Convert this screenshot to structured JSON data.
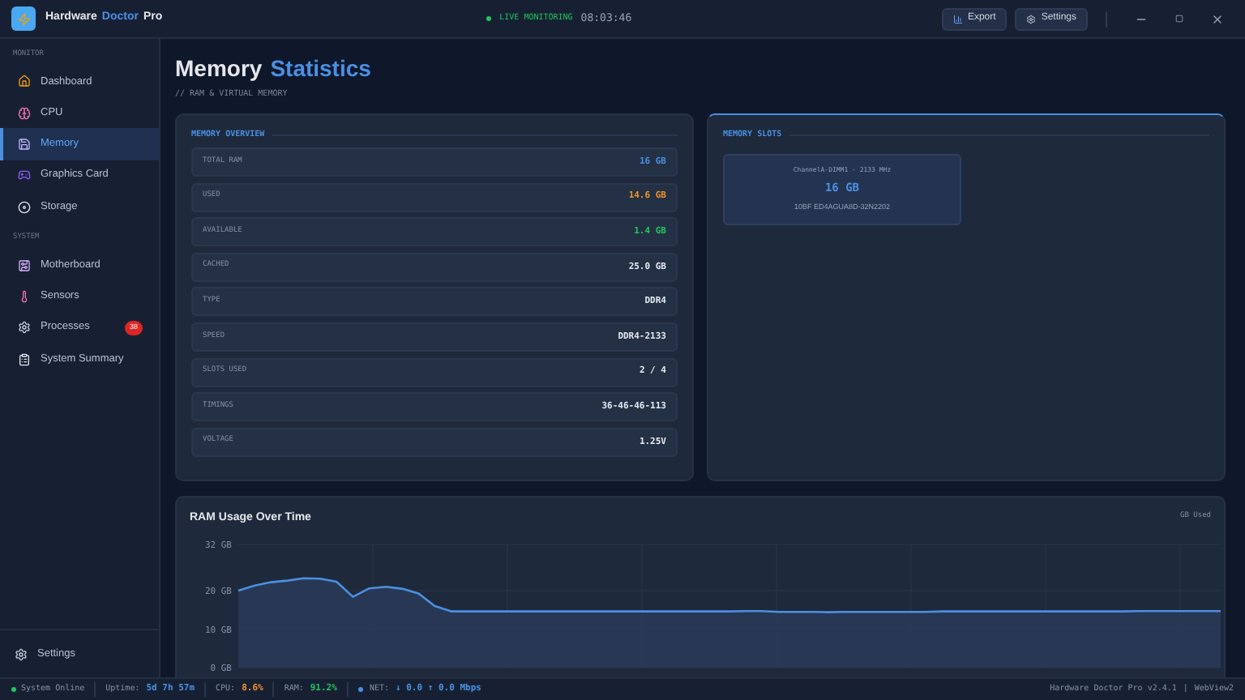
{
  "app": {
    "title_parts": [
      {
        "text": "Hardware",
        "accent": false
      },
      {
        "text": "Doctor",
        "accent": true
      },
      {
        "text": "Pro",
        "accent": false
      }
    ],
    "live": "LIVE MONITORING",
    "clock": "08:03:46",
    "buttons": [
      "Export",
      "Settings"
    ]
  },
  "sidebar": {
    "sections": [
      {
        "title": "MONITOR",
        "items": [
          {
            "label": "Dashboard",
            "selected": false
          },
          {
            "label": "CPU",
            "selected": false
          },
          {
            "label": "Memory",
            "selected": true
          },
          {
            "label": "Graphics Card",
            "selected": false
          },
          {
            "label": "Storage",
            "selected": false
          }
        ]
      },
      {
        "title": "SYSTEM",
        "items": [
          {
            "label": "Motherboard",
            "selected": false
          },
          {
            "label": "Sensors",
            "selected": false
          },
          {
            "label": "Processes",
            "selected": false,
            "badge": "38"
          },
          {
            "label": "System Summary",
            "selected": false
          }
        ]
      }
    ],
    "footer": {
      "label": "Settings"
    }
  },
  "page": {
    "title_parts": [
      {
        "text": "Memory",
        "accent": false
      },
      {
        "text": "Statistics",
        "accent": true
      }
    ],
    "subtitle": "// RAM & VIRTUAL MEMORY"
  },
  "overview": {
    "title": "MEMORY OVERVIEW",
    "rows": [
      {
        "label": "TOTAL RAM",
        "value": "16 GB",
        "color": "#4a90e2"
      },
      {
        "label": "USED",
        "value": "14.6 GB",
        "color": "#f0932b"
      },
      {
        "label": "AVAILABLE",
        "value": "1.4 GB",
        "color": "#22c55e"
      },
      {
        "label": "CACHED",
        "value": "25.0 GB",
        "color": "#e2e8f0"
      },
      {
        "label": "TYPE",
        "value": "DDR4",
        "color": "#e2e8f0"
      },
      {
        "label": "SPEED",
        "value": "DDR4-2133",
        "color": "#e2e8f0"
      },
      {
        "label": "SLOTS USED",
        "value": "2 / 4",
        "color": "#e2e8f0"
      },
      {
        "label": "TIMINGS",
        "value": "36-46-46-113",
        "color": "#e2e8f0"
      },
      {
        "label": "VOLTAGE",
        "value": "1.25V",
        "color": "#e2e8f0"
      }
    ]
  },
  "slots": {
    "title": "MEMORY SLOTS",
    "items": [
      {
        "name": "ChannelA-DIMM1 · 2133 MHz",
        "size": "16 GB",
        "part": "10BF ED4AGUA8D-32N2202"
      }
    ]
  },
  "usage": {
    "chart_data": {
      "type": "area",
      "title": "RAM Usage Over Time",
      "grid": true,
      "ylim": [
        0,
        32
      ],
      "yticks": [
        {
          "value": 0,
          "label": "0 GB"
        },
        {
          "value": 10,
          "label": "10 GB"
        },
        {
          "value": 20,
          "label": "20 GB"
        },
        {
          "value": 32,
          "label": "32 GB"
        }
      ],
      "series": [
        {
          "name": "GB Used",
          "color": "#4a90e2",
          "values": [
            20,
            21.3,
            22.2,
            22.6,
            23.2,
            23.1,
            22.3,
            18.4,
            20.6,
            21,
            20.5,
            19.3,
            16,
            14.6,
            14.6,
            14.6,
            14.6,
            14.6,
            14.6,
            14.6,
            14.6,
            14.6,
            14.6,
            14.6,
            14.6,
            14.6,
            14.6,
            14.6,
            14.6,
            14.6,
            14.6,
            14.7,
            14.7,
            14.5,
            14.5,
            14.5,
            14.4,
            14.5,
            14.5,
            14.5,
            14.5,
            14.5,
            14.5,
            14.6,
            14.6,
            14.6,
            14.6,
            14.6,
            14.6,
            14.6,
            14.6,
            14.6,
            14.6,
            14.6,
            14.6,
            14.7,
            14.7,
            14.7,
            14.7,
            14.7,
            14.7
          ]
        }
      ]
    }
  },
  "status_bar": {
    "online": "System Online",
    "items": [
      {
        "label": "Uptime:",
        "value": "5d 7h 57m",
        "color": "#4a90e2"
      },
      {
        "label": "CPU:",
        "value": "8.6%",
        "color": "#f0932b"
      },
      {
        "label": "RAM:",
        "value": "91.2%",
        "color": "#22c55e"
      },
      {
        "label": "NET:",
        "value": "↓ 0.0 ↑ 0.0 Mbps",
        "color": "#4a90e2"
      }
    ],
    "version": "Hardware Doctor Pro v2.4.1",
    "separator": "|",
    "engine": "WebView2"
  }
}
